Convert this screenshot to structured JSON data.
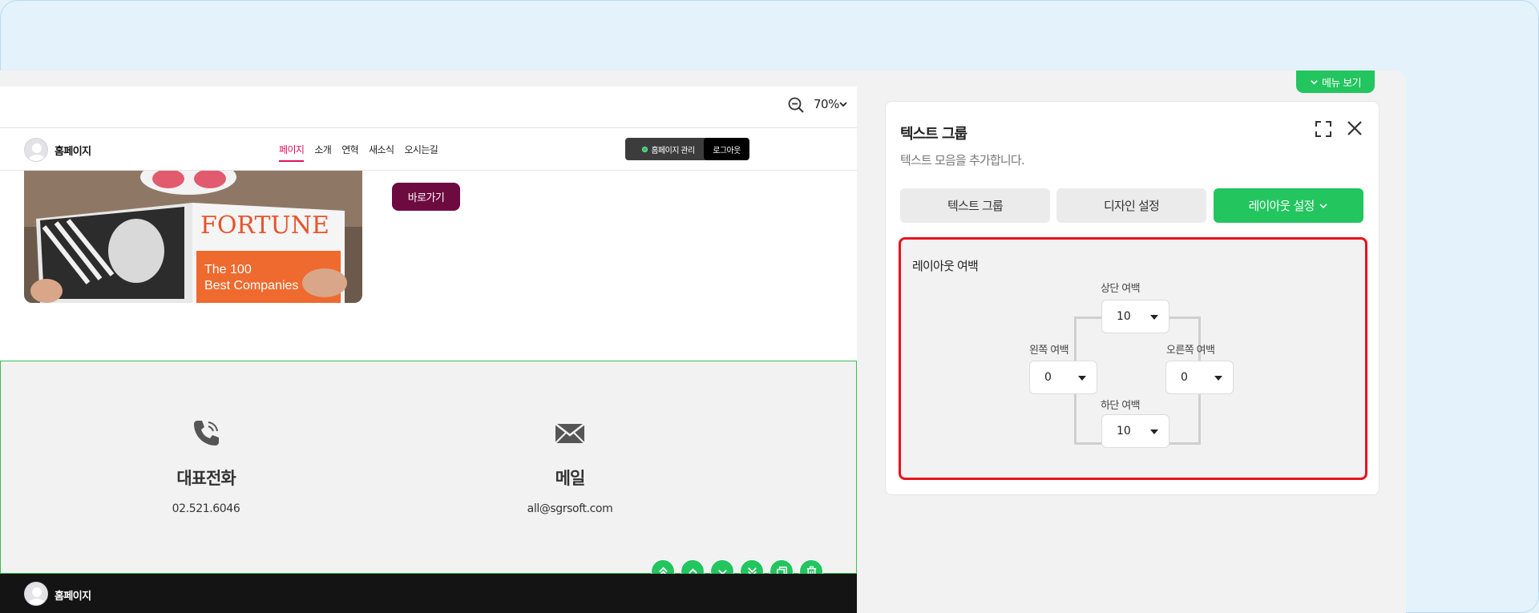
{
  "preview": {
    "zoom": {
      "value": "70%"
    },
    "site": {
      "logo_text": "홈페이지",
      "nav": [
        "페이지",
        "소개",
        "연혁",
        "새소식",
        "오시는길"
      ],
      "active_nav_index": 0,
      "admin_button": "홈페이지 관리",
      "logout_button": "로그아웃"
    },
    "hero": {
      "button_label": "바로가기"
    },
    "contact": {
      "phone": {
        "icon": "phone-icon",
        "title": "대표전화",
        "value": "02.521.6046"
      },
      "email": {
        "icon": "mail-icon",
        "title": "메일",
        "value": "all@sgrsoft.com"
      }
    },
    "section_tools": [
      {
        "icon": "move-top-icon"
      },
      {
        "icon": "move-up-icon"
      },
      {
        "icon": "move-down-icon"
      },
      {
        "icon": "move-bottom-icon"
      },
      {
        "icon": "copy-icon"
      },
      {
        "icon": "trash-icon"
      }
    ],
    "footer": {
      "logo_text": "홈페이지"
    }
  },
  "panel": {
    "menu_view_button": "메뉴 보기",
    "title": "텍스트 그룹",
    "description": "텍스트 모음을 추가합니다.",
    "tabs": [
      {
        "label": "텍스트 그룹"
      },
      {
        "label": "디자인 설정"
      },
      {
        "label": "레이아웃 설정"
      }
    ],
    "active_tab_index": 2,
    "layout": {
      "title": "레이아웃 여백",
      "top": {
        "label": "상단 여백",
        "value": "10"
      },
      "left": {
        "label": "왼쪽 여백",
        "value": "0"
      },
      "right": {
        "label": "오른쪽 여백",
        "value": "0"
      },
      "bottom": {
        "label": "하단 여백",
        "value": "10"
      }
    }
  },
  "colors": {
    "accent": "#22c55e",
    "highlight": "#e8131d",
    "nav_active": "#e0115f",
    "go_button": "#6d0a3f",
    "background": "#e3f2fb"
  }
}
